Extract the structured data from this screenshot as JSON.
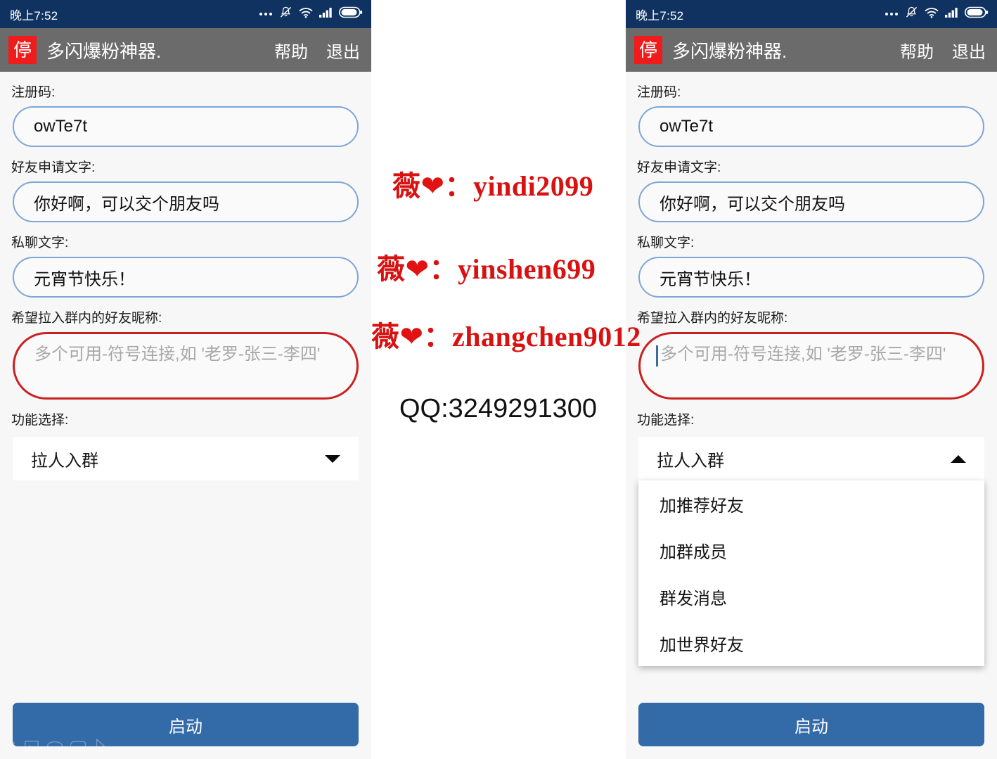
{
  "status_bar": {
    "time": "晚上7:52",
    "icons": [
      "more-dots-icon",
      "bell-muted-icon",
      "wifi-icon",
      "signal-bars-icon",
      "battery-icon"
    ]
  },
  "app_bar": {
    "icon_text": "停",
    "title": "多闪爆粉神器.",
    "help_label": "帮助",
    "exit_label": "退出"
  },
  "form": {
    "reg_code_label": "注册码:",
    "reg_code_value": "owTe7t",
    "friend_request_label": "好友申请文字:",
    "friend_request_value": "你好啊，可以交个朋友吗",
    "private_chat_label": "私聊文字:",
    "private_chat_value": "元宵节快乐！",
    "nickname_label": "希望拉入群内的好友昵称:",
    "nickname_placeholder": "多个可用-符号连接,如 '老罗-张三-李四'",
    "nickname_value": "",
    "function_label": "功能选择:",
    "function_selected": "拉人入群",
    "function_options": [
      "加推荐好友",
      "加群成员",
      "群发消息",
      "加世界好友"
    ]
  },
  "actions": {
    "start_label": "启动"
  },
  "contact": {
    "prefix": "薇",
    "heart": "❤",
    "colon": "：",
    "wechat_1": "yindi2099",
    "wechat_2": "yinshen699",
    "wechat_3": "zhangchen9012",
    "qq": "QQ:3249291300"
  },
  "colors": {
    "status_bar": "#103261",
    "app_bar": "#6b6b6b",
    "app_icon": "#f01b1b",
    "input_border": "#7ea6d8",
    "highlight_border": "#cc1f1f",
    "primary_button": "#336aa8",
    "contact_red": "#d81111",
    "page_background": "#f7f7f7"
  }
}
